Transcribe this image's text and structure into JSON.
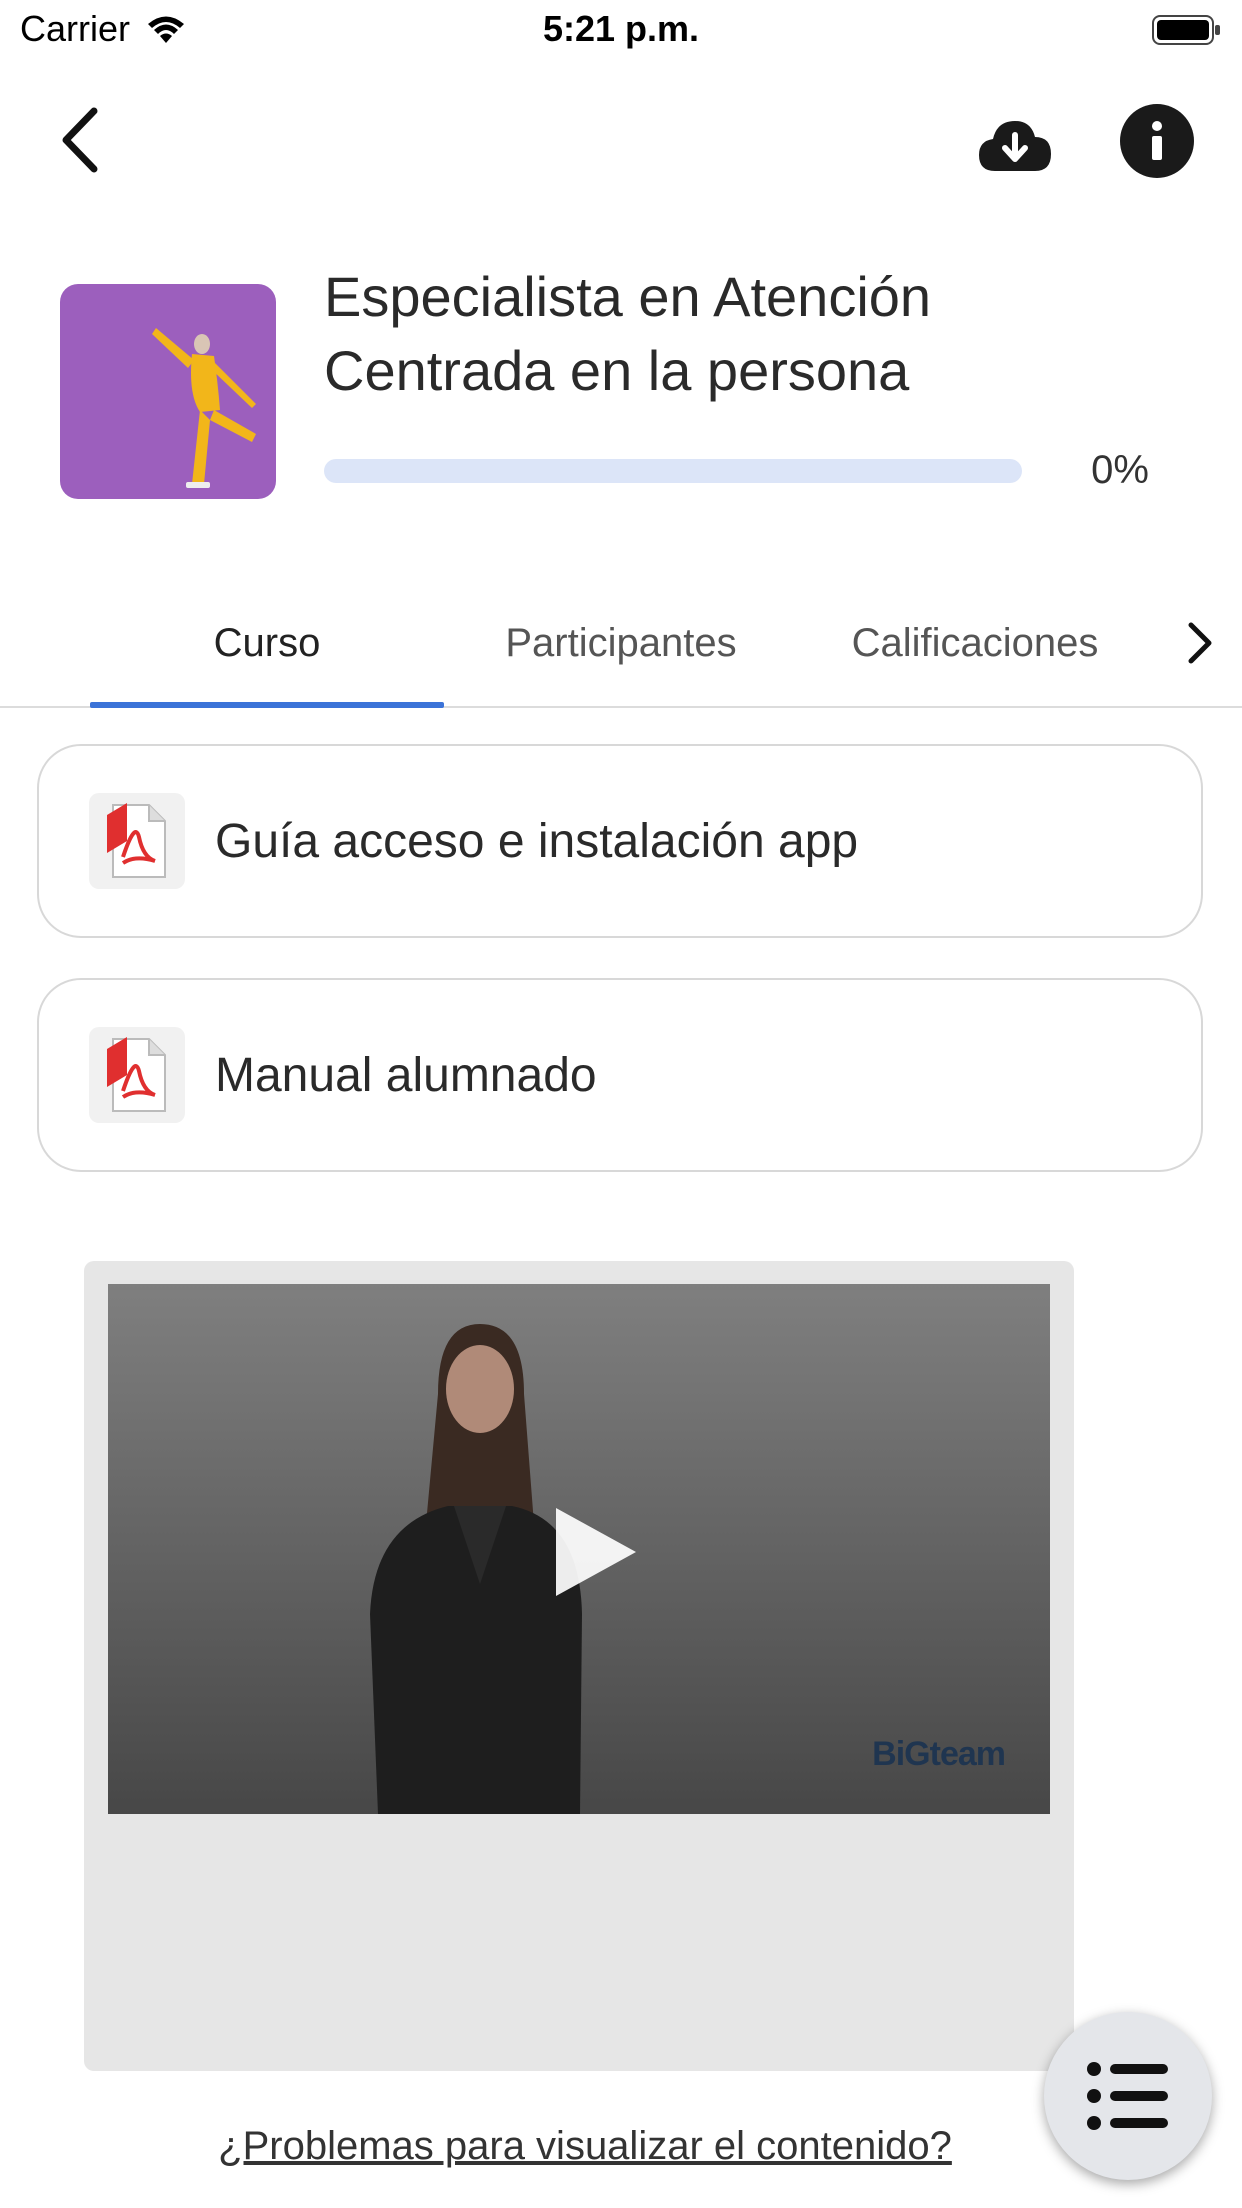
{
  "status_bar": {
    "carrier": "Carrier",
    "time": "5:21 p.m."
  },
  "toolbar": {
    "back_icon": "chevron-left-icon",
    "download_icon": "cloud-download-icon",
    "info_icon": "info-icon"
  },
  "course": {
    "title": "Especialista en Atención Centrada en la persona",
    "progress_percent": 0,
    "progress_label": "0%"
  },
  "tabs": [
    {
      "label": "Curso",
      "active": true
    },
    {
      "label": "Participantes",
      "active": false
    },
    {
      "label": "Calificaciones",
      "active": false
    }
  ],
  "resources": [
    {
      "label": "Guía acceso e instalación app",
      "icon": "pdf-icon"
    },
    {
      "label": "Manual alumnado",
      "icon": "pdf-icon"
    }
  ],
  "video": {
    "watermark": "BiGteam"
  },
  "help_link": "¿Problemas para visualizar el contenido?",
  "colors": {
    "accent": "#3b73d8",
    "thumbnail_bg": "#9c5fbd",
    "progress_track": "#dce5f8"
  }
}
